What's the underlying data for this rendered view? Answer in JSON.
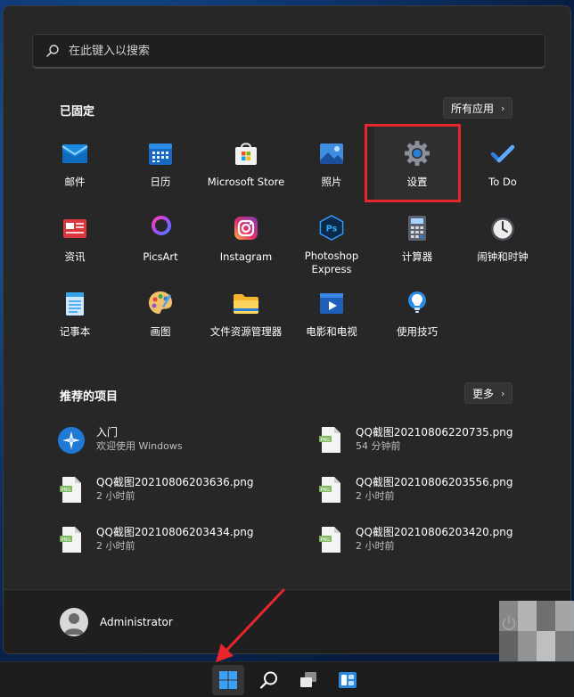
{
  "search": {
    "placeholder": "在此键入以搜索"
  },
  "pinned": {
    "title": "已固定",
    "all_apps_label": "所有应用",
    "apps": [
      {
        "label": "邮件",
        "icon": "mail-icon"
      },
      {
        "label": "日历",
        "icon": "calendar-icon"
      },
      {
        "label": "Microsoft Store",
        "icon": "store-icon"
      },
      {
        "label": "照片",
        "icon": "photos-icon"
      },
      {
        "label": "设置",
        "icon": "gear-icon"
      },
      {
        "label": "To Do",
        "icon": "todo-icon"
      },
      {
        "label": "资讯",
        "icon": "news-icon"
      },
      {
        "label": "PicsArt",
        "icon": "picsart-icon"
      },
      {
        "label": "Instagram",
        "icon": "instagram-icon"
      },
      {
        "label": "Photoshop\nExpress",
        "icon": "photoshop-icon"
      },
      {
        "label": "计算器",
        "icon": "calculator-icon"
      },
      {
        "label": "闹钟和时钟",
        "icon": "clock-icon"
      },
      {
        "label": "记事本",
        "icon": "notepad-icon"
      },
      {
        "label": "画图",
        "icon": "paint-icon"
      },
      {
        "label": "文件资源管理器",
        "icon": "folder-icon"
      },
      {
        "label": "电影和电视",
        "icon": "movies-icon"
      },
      {
        "label": "使用技巧",
        "icon": "tips-icon"
      }
    ]
  },
  "recommended": {
    "title": "推荐的项目",
    "more_label": "更多",
    "items": [
      {
        "name": "入门",
        "sub": "欢迎使用 Windows",
        "icon": "get-started-icon"
      },
      {
        "name": "QQ截图20210806220735.png",
        "sub": "54 分钟前",
        "icon": "png-file-icon"
      },
      {
        "name": "QQ截图20210806203636.png",
        "sub": "2 小时前",
        "icon": "png-file-icon"
      },
      {
        "name": "QQ截图20210806203556.png",
        "sub": "2 小时前",
        "icon": "png-file-icon"
      },
      {
        "name": "QQ截图20210806203434.png",
        "sub": "2 小时前",
        "icon": "png-file-icon"
      },
      {
        "name": "QQ截图20210806203420.png",
        "sub": "2 小时前",
        "icon": "png-file-icon"
      }
    ]
  },
  "user": {
    "name": "Administrator"
  },
  "colors": {
    "highlight": "#e8262b",
    "menu_bg": "#272727",
    "accent": "#0078d4"
  }
}
